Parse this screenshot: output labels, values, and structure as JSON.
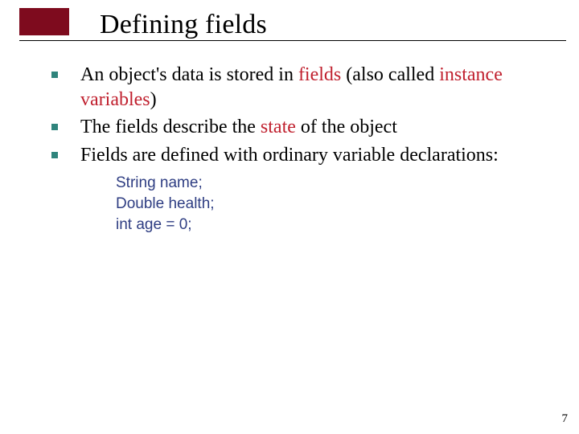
{
  "title": "Defining fields",
  "bullets": [
    {
      "parts": [
        "An object's data is stored in ",
        "fields",
        " (also called ",
        "instance variables",
        ")"
      ]
    },
    {
      "parts": [
        "The fields describe the ",
        "state",
        " of the object"
      ]
    },
    {
      "parts": [
        "Fields are defined with ordinary variable declarations:"
      ]
    }
  ],
  "code": [
    "String name;",
    "Double health;",
    "int age = 0;"
  ],
  "page_number": "7",
  "colors": {
    "accent_block": "#7e0b1e",
    "bullet_square": "#2f847c",
    "highlight_text": "#c0202e",
    "code_text": "#2e3d82"
  }
}
